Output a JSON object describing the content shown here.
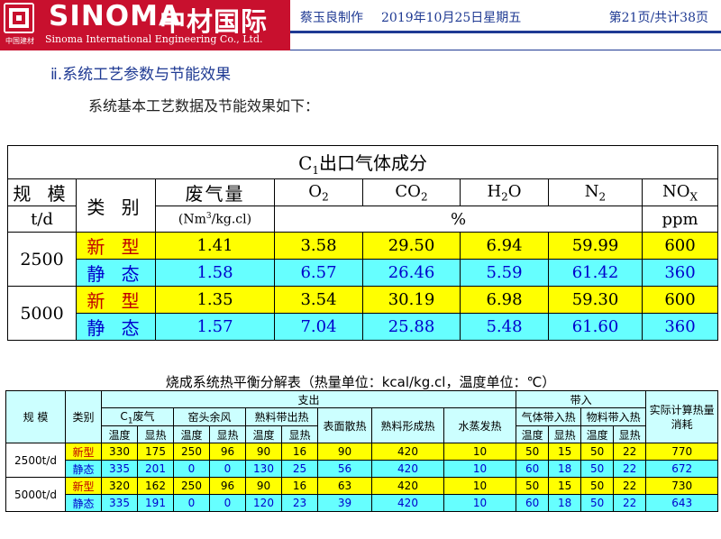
{
  "header": {
    "logo_word": "SINOMA",
    "logo_cn": "中材国际",
    "logo_en": "Sinoma International Engineering   Co., Ltd.",
    "logo_small": "中国建材",
    "author": "蔡玉良制作",
    "date": "2019年10月25日星期五",
    "page": "第21页/共计38页"
  },
  "section": {
    "title": "ⅱ.系统工艺参数与节能效果",
    "text": "系统基本工艺数据及节能效果如下："
  },
  "table1": {
    "title": "C1出口气体成分",
    "col_scale": "规 模",
    "col_type": "类 别",
    "col_waste": "废气量",
    "gases": [
      "O2",
      "CO2",
      "H2O",
      "N2",
      "NOX"
    ],
    "unit_scale": "t/d",
    "unit_waste": "(Nm3/kg.cl)",
    "unit_pct": "%",
    "unit_ppm": "ppm",
    "rows": [
      {
        "scale": "2500",
        "type": "新 型",
        "waste": "1.41",
        "o2": "3.58",
        "co2": "29.50",
        "h2o": "6.94",
        "n2": "59.99",
        "nox": "600"
      },
      {
        "type": "静 态",
        "waste": "1.58",
        "o2": "6.57",
        "co2": "26.46",
        "h2o": "5.59",
        "n2": "61.42",
        "nox": "360"
      },
      {
        "scale": "5000",
        "type": "新 型",
        "waste": "1.35",
        "o2": "3.54",
        "co2": "30.19",
        "h2o": "6.98",
        "n2": "59.30",
        "nox": "600"
      },
      {
        "type": "静 态",
        "waste": "1.57",
        "o2": "7.04",
        "co2": "25.88",
        "h2o": "5.48",
        "n2": "61.60",
        "nox": "360"
      }
    ]
  },
  "table2": {
    "title": "烧成系统热平衡分解表（热量单位：kcal/kg.cl，温度单位：℃）",
    "h_scale": "规 模",
    "h_type": "类别",
    "h_out": "支出",
    "h_in": "带入",
    "h_actual": "实际计算热量消耗",
    "h_c1": "C1废气",
    "h_kiln": "窑头余风",
    "h_clinker_out": "熟料带出热",
    "h_surface": "表面散热",
    "h_formation": "熟料形成热",
    "h_water": "水蒸发热",
    "h_gas_in": "气体带入热",
    "h_mat_in": "物料带入热",
    "h_temp": "温度",
    "h_heat": "显热",
    "rows": [
      {
        "scale": "2500t/d",
        "type": "新型",
        "v": [
          "330",
          "175",
          "250",
          "96",
          "90",
          "16",
          "90",
          "420",
          "10",
          "50",
          "15",
          "50",
          "22",
          "770"
        ]
      },
      {
        "type": "静态",
        "v": [
          "335",
          "201",
          "0",
          "0",
          "130",
          "25",
          "56",
          "420",
          "10",
          "60",
          "18",
          "50",
          "22",
          "672"
        ]
      },
      {
        "scale": "5000t/d",
        "type": "新型",
        "v": [
          "320",
          "162",
          "250",
          "96",
          "90",
          "16",
          "63",
          "420",
          "10",
          "50",
          "15",
          "50",
          "22",
          "730"
        ]
      },
      {
        "type": "静态",
        "v": [
          "335",
          "191",
          "0",
          "0",
          "120",
          "23",
          "39",
          "420",
          "10",
          "60",
          "18",
          "50",
          "22",
          "643"
        ]
      }
    ]
  },
  "colors": {
    "brand_red": "#c8102e",
    "header_blue": "#1f3a93",
    "row_yellow": "#ffff00",
    "row_cyan": "#66ffff"
  }
}
